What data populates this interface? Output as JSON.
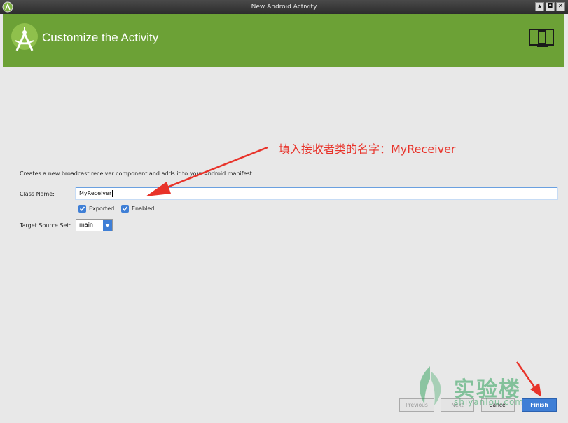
{
  "window": {
    "title": "New Android Activity",
    "controls": {
      "restore": "▴",
      "maximize": "◘",
      "close": "✕"
    }
  },
  "banner": {
    "title": "Customize the Activity",
    "logo_icon": "android-studio-icon",
    "device_icon": "tablet-phone-icon",
    "color": "#6ca136"
  },
  "form": {
    "description": "Creates a new broadcast receiver component and adds it to your Android manifest.",
    "class_name_label": "Class Name:",
    "class_name_value": "MyReceiver",
    "exported_label": "Exported",
    "enabled_label": "Enabled",
    "target_source_label": "Target Source Set:",
    "target_source_value": "main"
  },
  "buttons": {
    "previous": "Previous",
    "next": "Next",
    "cancel": "Cancel",
    "finish": "Finish"
  },
  "annotation": {
    "text": "填入接收者类的名字：MyReceiver",
    "color": "#e8332a"
  },
  "watermark": {
    "text": "实验楼",
    "sub": "shiyanlou.com"
  }
}
